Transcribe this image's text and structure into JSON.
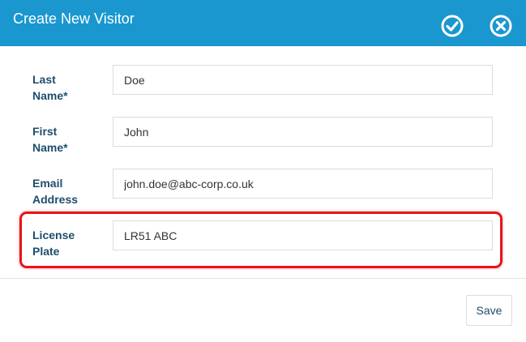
{
  "dialog": {
    "title": "Create New Visitor",
    "header_color": "#1a97cf"
  },
  "header_buttons": {
    "confirm_icon": "check-circle-icon",
    "close_icon": "close-circle-icon"
  },
  "form": {
    "fields": [
      {
        "label_line1": "Last",
        "label_line2": "Name*",
        "value": "Doe"
      },
      {
        "label_line1": "First",
        "label_line2": "Name*",
        "value": "John"
      },
      {
        "label_line1": "Email",
        "label_line2": "Address",
        "value": "john.doe@abc-corp.co.uk"
      },
      {
        "label_line1": "License",
        "label_line2": "Plate",
        "value": "LR51 ABC"
      }
    ]
  },
  "highlight_color": "#e8141b",
  "footer": {
    "save_label": "Save"
  }
}
